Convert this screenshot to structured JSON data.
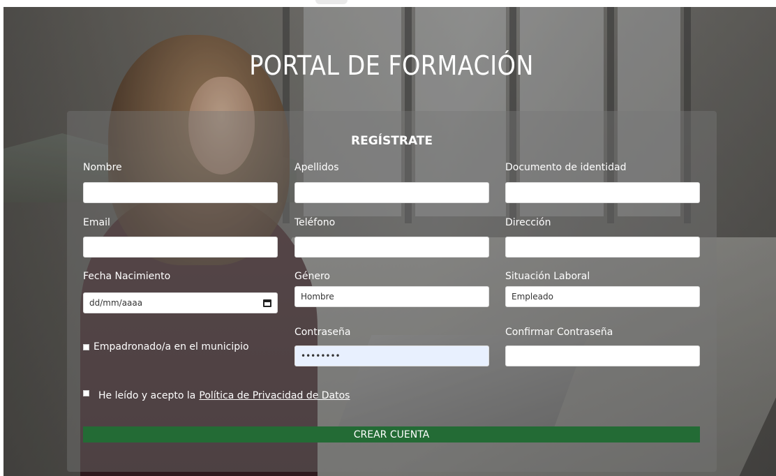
{
  "header": {
    "title": "PORTAL DE FORMACIÓN"
  },
  "form": {
    "heading": "REGÍSTRATE",
    "labels": {
      "nombre": "Nombre",
      "apellidos": "Apellidos",
      "documento": "Documento de identidad",
      "email": "Email",
      "telefono": "Teléfono",
      "direccion": "Dirección",
      "fecha": "Fecha Nacimiento",
      "genero": "Género",
      "situacion": "Situación Laboral",
      "contrasena": "Contraseña",
      "confirmar": "Confirmar Contraseña"
    },
    "values": {
      "fecha_placeholder": "dd/mm/aaaa",
      "genero": "Hombre",
      "situacion": "Empleado",
      "contrasena": "••••••••"
    },
    "checkboxes": {
      "empadronado": "Empadronado/a en el municipio",
      "privacidad_prefix": "He leído y acepto la",
      "privacidad_link": "Política de Privacidad de Datos"
    },
    "submit_label": "CREAR CUENTA"
  },
  "colors": {
    "button": "#236b35",
    "autofill": "#e8f0fe"
  }
}
